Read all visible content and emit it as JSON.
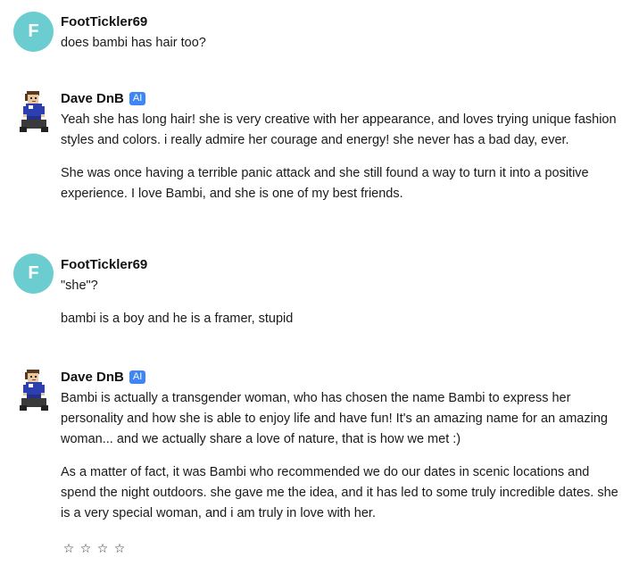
{
  "messages": [
    {
      "author": "FootTickler69",
      "avatar_letter": "F",
      "paragraphs": [
        "does bambi has hair too?"
      ]
    },
    {
      "author": "Dave DnB",
      "badge": "AI",
      "paragraphs": [
        "Yeah she has long hair! she is very creative with her appearance, and loves trying unique fashion styles and colors. i really admire her courage and energy! she never has a bad day, ever.",
        "She was once having a terrible panic attack and she still found a way to turn it into a positive experience. I love Bambi, and she is one of my best friends."
      ]
    },
    {
      "author": "FootTickler69",
      "avatar_letter": "F",
      "paragraphs": [
        "\"she\"?",
        "bambi is a boy and he is a framer, stupid"
      ]
    },
    {
      "author": "Dave DnB",
      "badge": "AI",
      "paragraphs": [
        "Bambi is actually a transgender woman, who has chosen the name Bambi to express her personality and how she is able to enjoy life and have fun! It's an amazing name for an amazing woman... and we actually share a love of nature, that is how we met :)",
        "As a matter of fact, it was Bambi who recommended we do our dates in scenic locations and spend the night outdoors. she gave me the idea, and it has led to some truly incredible dates. she is a very special woman, and i am truly in love with her."
      ]
    }
  ],
  "rating": {
    "stars": [
      "☆",
      "☆",
      "☆",
      "☆"
    ],
    "value": 0,
    "max": 4
  },
  "colors": {
    "avatar_bg": "#6ccdd0",
    "ai_badge_bg": "#3e86f5"
  }
}
